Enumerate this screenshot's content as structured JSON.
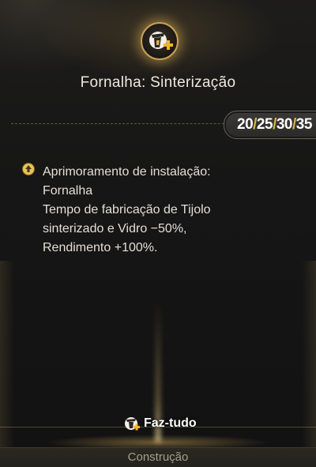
{
  "header": {
    "emblem_icon": "fornalha-plus-icon",
    "title": "Fornalha: Sinterização",
    "levels": [
      "20",
      "25",
      "30",
      "35"
    ],
    "level_separator": "/"
  },
  "description": {
    "icon": "upgrade-arrow-icon",
    "lines": [
      "Aprimoramento de instalação:",
      "Fornalha",
      "Tempo de fabricação de Tijolo",
      "sinterizado e Vidro −50%,",
      "Rendimento +100%."
    ]
  },
  "craft": {
    "icon": "faz-tudo-icon",
    "label": "Faz-tudo"
  },
  "footer": {
    "label": "Construção"
  },
  "colors": {
    "accent_gold": "#d9b24a",
    "background": "#141414",
    "text": "#e4dfd5"
  }
}
